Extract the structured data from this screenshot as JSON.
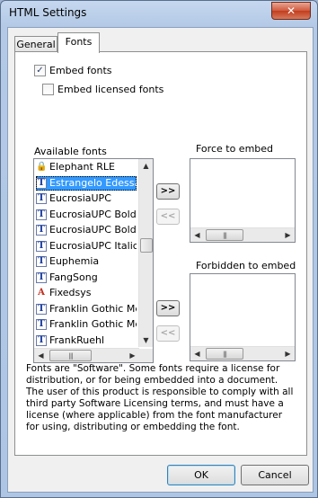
{
  "window": {
    "title": "HTML Settings",
    "close_glyph": "✕"
  },
  "tabs": [
    {
      "label": "General"
    },
    {
      "label": "Fonts"
    }
  ],
  "options": {
    "embed_fonts": {
      "label": "Embed fonts",
      "checked": true
    },
    "embed_licensed": {
      "label": "Embed licensed fonts",
      "checked": false
    }
  },
  "available": {
    "label": "Available fonts",
    "items": [
      {
        "name": "Elephant RLE",
        "icon": "lock-icon"
      },
      {
        "name": "Estrangelo Edessa",
        "icon": "truetype-icon",
        "selected": true
      },
      {
        "name": "EucrosiaUPC",
        "icon": "truetype-icon"
      },
      {
        "name": "EucrosiaUPC Bold",
        "icon": "truetype-icon"
      },
      {
        "name": "EucrosiaUPC Bold I",
        "icon": "truetype-icon"
      },
      {
        "name": "EucrosiaUPC Italic",
        "icon": "truetype-icon"
      },
      {
        "name": "Euphemia",
        "icon": "truetype-icon"
      },
      {
        "name": "FangSong",
        "icon": "truetype-icon"
      },
      {
        "name": "Fixedsys",
        "icon": "raster-font-icon"
      },
      {
        "name": "Franklin Gothic Med",
        "icon": "truetype-icon"
      },
      {
        "name": "Franklin Gothic Med",
        "icon": "truetype-icon"
      },
      {
        "name": "FrankRuehl",
        "icon": "truetype-icon"
      }
    ]
  },
  "force": {
    "label": "Force to embed"
  },
  "forbidden": {
    "label": "Forbidden to embed"
  },
  "move": {
    "add": ">>",
    "remove": "<<"
  },
  "info_text": "Fonts are \"Software\". Some fonts require a license for distribution, or for being embedded into a document. The user of this product is responsible to comply with all third party Software Licensing terms, and must have a license (where applicable) from the font manufacturer for using, distributing or embedding the font.",
  "buttons": {
    "ok": "OK",
    "cancel": "Cancel"
  }
}
